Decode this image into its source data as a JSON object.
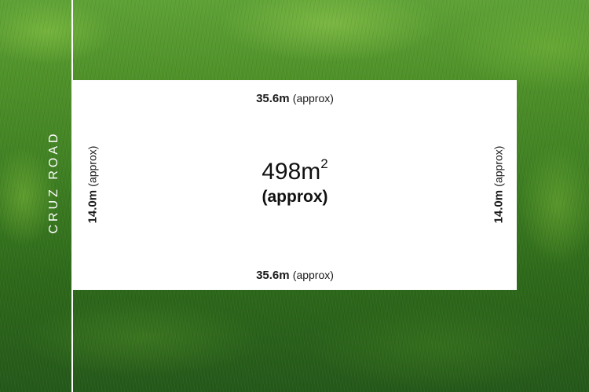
{
  "street": {
    "name": "CRUZ ROAD"
  },
  "lot": {
    "top": {
      "value": "35.6m",
      "qualifier": "(approx)"
    },
    "bottom": {
      "value": "35.6m",
      "qualifier": "(approx)"
    },
    "left": {
      "value": "14.0m",
      "qualifier": "(approx)"
    },
    "right": {
      "value": "14.0m",
      "qualifier": "(approx)"
    },
    "area": {
      "value": "498m",
      "superscript": "2",
      "qualifier": "(approx)"
    }
  },
  "colors": {
    "grass": "#3e7f22",
    "lot": "#ffffff",
    "road_line": "#ffffff"
  }
}
